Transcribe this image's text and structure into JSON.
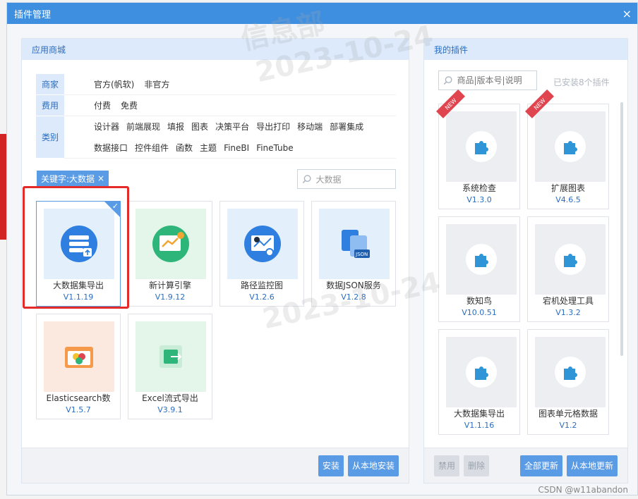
{
  "dialog": {
    "title": "插件管理",
    "close": "×"
  },
  "left": {
    "header": "应用商城",
    "filters": [
      {
        "label": "商家",
        "values": [
          "官方(帆软)",
          "非官方"
        ]
      },
      {
        "label": "费用",
        "values": [
          "付费",
          "免费"
        ]
      },
      {
        "label": "类别",
        "values": [
          "设计器",
          "前端展现",
          "填报",
          "图表",
          "决策平台",
          "导出打印",
          "移动端",
          "部署集成",
          "数据接口",
          "控件组件",
          "函数",
          "主题",
          "FineBI",
          "FineTube"
        ]
      }
    ],
    "keyword_tag": "关键字:大数据",
    "tag_close": "×",
    "search_value": "大数据",
    "cards": [
      {
        "name": "大数据集导出",
        "version": "V1.1.19"
      },
      {
        "name": "新计算引擎",
        "version": "V1.9.12"
      },
      {
        "name": "路径监控图",
        "version": "V1.2.6"
      },
      {
        "name": "数据JSON服务",
        "version": "V1.2.8"
      },
      {
        "name": "Elasticsearch数",
        "version": "V1.5.7"
      },
      {
        "name": "Excel流式导出",
        "version": "V3.9.1"
      }
    ],
    "buttons": {
      "install": "安装",
      "local_install": "从本地安装"
    }
  },
  "right": {
    "header": "我的插件",
    "search_placeholder": "商品|版本号|说明",
    "installed_count": "已安装8个插件",
    "ribbon": "NEW",
    "cards": [
      {
        "name": "系统检查",
        "version": "V1.3.0"
      },
      {
        "name": "扩展图表",
        "version": "V4.6.5"
      },
      {
        "name": "数知鸟",
        "version": "V10.0.51"
      },
      {
        "name": "宕机处理工具",
        "version": "V1.3.2"
      },
      {
        "name": "大数据集导出",
        "version": "V1.1.16"
      },
      {
        "name": "图表单元格数据",
        "version": "V1.2"
      }
    ],
    "buttons": {
      "disable": "禁用",
      "delete": "删除",
      "update_all": "全部更新",
      "local_update": "从本地更新"
    }
  },
  "watermark": {
    "line1": "信息部",
    "line2": "2023-10-24"
  },
  "credit": "CSDN @w11abandon",
  "colors": {
    "accent": "#5a9be6",
    "title_bar": "#3f8fe0",
    "highlight": "#e52a2a",
    "ribbon": "#e0454f"
  }
}
